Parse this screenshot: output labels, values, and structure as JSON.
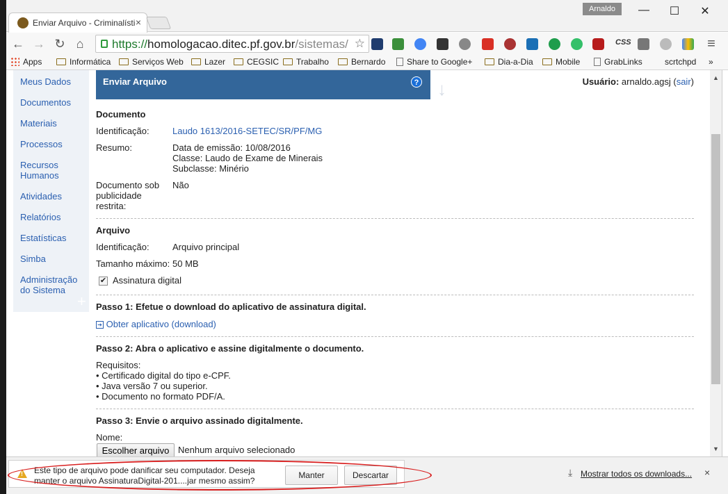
{
  "window": {
    "tab_title": "Enviar Arquivo - Criminalística",
    "tab_close": "×",
    "user_badge": "Arnaldo",
    "minimize": "—",
    "maximize": "☐",
    "close": "✕"
  },
  "toolbar": {
    "back": "←",
    "forward": "→",
    "reload": "↻",
    "home": "⌂",
    "url_scheme": "https://",
    "url_host": "homologacao.ditec.pf.gov.br",
    "url_path": "/sistemas/criminalistica",
    "star": "☆",
    "menu": "≡",
    "css_label": "CSS"
  },
  "bookmarks": [
    {
      "label": "Apps",
      "icon": "apps-grid-icon"
    },
    {
      "label": "Informática",
      "icon": "folder-icon"
    },
    {
      "label": "Serviços Web",
      "icon": "folder-icon"
    },
    {
      "label": "Lazer",
      "icon": "folder-icon"
    },
    {
      "label": "CEGSIC",
      "icon": "folder-icon"
    },
    {
      "label": "Trabalho",
      "icon": "folder-icon"
    },
    {
      "label": "Bernardo",
      "icon": "folder-icon"
    },
    {
      "label": "Share to Google+",
      "icon": "page-icon"
    },
    {
      "label": "Dia-a-Dia",
      "icon": "folder-icon"
    },
    {
      "label": "Mobile",
      "icon": "folder-icon"
    },
    {
      "label": "GrabLinks",
      "icon": "page-icon"
    },
    {
      "label": "scrtchpd",
      "icon": "none"
    },
    {
      "label": "»",
      "icon": "none"
    }
  ],
  "sidebar": {
    "items": [
      "Meus Dados",
      "Documentos",
      "Materiais",
      "Processos",
      "Recursos Humanos",
      "Atividades",
      "Relatórios",
      "Estatísticas",
      "Simba",
      "Administração do Sistema"
    ],
    "plus": "+"
  },
  "panel": {
    "title": "Enviar Arquivo",
    "help": "?"
  },
  "user": {
    "label": "Usuário:",
    "name": "arnaldo.agsj",
    "logout": "sair"
  },
  "documento": {
    "heading": "Documento",
    "id_label": "Identificação:",
    "id_value": "Laudo 1613/2016-SETEC/SR/PF/MG",
    "resumo_label": "Resumo:",
    "resumo_lines": [
      "Data de emissão: 10/08/2016",
      "Classe: Laudo de Exame de Minerais",
      "Subclasse: Minério"
    ],
    "sob_label_lines": [
      "Documento sob",
      "publicidade",
      "restrita:"
    ],
    "sob_value": "Não"
  },
  "arquivo": {
    "heading": "Arquivo",
    "id_label": "Identificação:",
    "id_value": "Arquivo principal",
    "tamanho_label": "Tamanho máximo:",
    "tamanho_value": "50 MB",
    "assinatura_label": "Assinatura digital",
    "assinatura_checked": true
  },
  "passo1": {
    "heading": "Passo 1: Efetue o download do aplicativo de assinatura digital.",
    "link": "Obter aplicativo (download)"
  },
  "passo2": {
    "heading": "Passo 2: Abra o aplicativo e assine digitalmente o documento.",
    "req_title": "Requisitos:",
    "reqs": [
      "• Certificado digital do tipo e-CPF.",
      "• Java versão 7 ou superior.",
      "• Documento no formato PDF/A."
    ]
  },
  "passo3": {
    "heading": "Passo 3: Envie o arquivo assinado digitalmente.",
    "name_label": "Nome:",
    "choose_button": "Escolher arquivo",
    "no_file": "Nenhum arquivo selecionado"
  },
  "download_bar": {
    "warning_line1": "Este tipo de arquivo pode danificar seu computador. Deseja",
    "warning_line2": "manter o arquivo AssinaturaDigital-201....jar mesmo assim?",
    "keep": "Manter",
    "discard": "Descartar",
    "show_all": "Mostrar todos os downloads...",
    "close": "×"
  },
  "colors": {
    "panel_header": "#33669a",
    "link": "#2a5fb0",
    "highlight": "#d81e1e"
  }
}
